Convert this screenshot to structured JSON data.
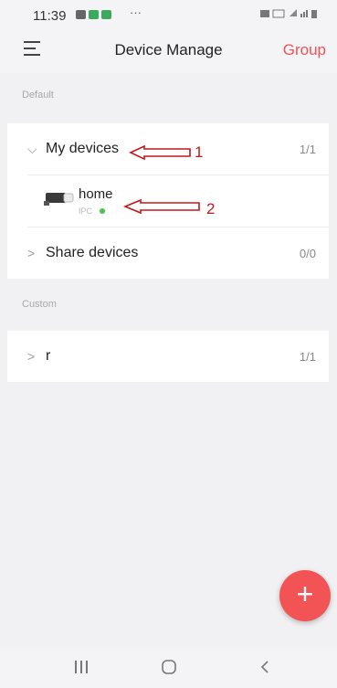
{
  "status_bar": {
    "time": "11:39",
    "more": "···"
  },
  "header": {
    "title": "Device Manage",
    "group_label": "Group",
    "accent": "#f05354"
  },
  "sections": [
    {
      "label": "Default"
    },
    {
      "label": "Custom"
    }
  ],
  "default_groups": [
    {
      "label": "My devices",
      "count": "1/1",
      "expanded": true
    },
    {
      "label": "Share devices",
      "count": "0/0",
      "expanded": false
    }
  ],
  "device": {
    "name": "home",
    "type": "IPC",
    "status_color": "#4cc24a"
  },
  "custom_groups": [
    {
      "label": "r",
      "count": "1/1",
      "expanded": false
    }
  ],
  "annotations": [
    {
      "number": "1"
    },
    {
      "number": "2"
    }
  ],
  "fab": {
    "icon": "plus-icon",
    "color": "#f25455"
  },
  "bottom_nav": {
    "recent": "recent-apps-icon",
    "home": "home-icon",
    "back": "back-icon"
  }
}
